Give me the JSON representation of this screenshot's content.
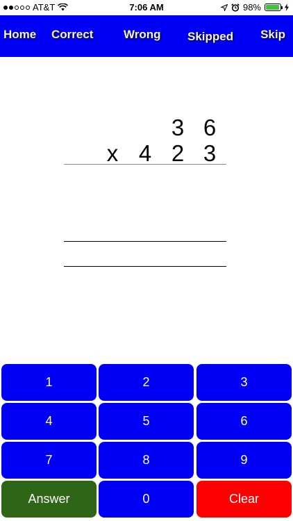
{
  "status": {
    "carrier": "AT&T",
    "time": "7:06 AM",
    "battery_text": "98%",
    "battery_level": 0.98,
    "signal_bars": 2
  },
  "nav": {
    "home": "Home",
    "correct": "Correct",
    "wrong": "Wrong",
    "skipped": "Skipped",
    "skip": "Skip"
  },
  "problem": {
    "top_digits": [
      "3",
      "6"
    ],
    "operator": "x",
    "bottom_digits": [
      "4",
      "2",
      "3"
    ]
  },
  "keypad": {
    "k1": "1",
    "k2": "2",
    "k3": "3",
    "k4": "4",
    "k5": "5",
    "k6": "6",
    "k7": "7",
    "k8": "8",
    "k9": "9",
    "answer": "Answer",
    "k0": "0",
    "clear": "Clear"
  },
  "colors": {
    "nav_background": "#0000f5",
    "key_blue": "#0000f5",
    "answer_green": "#2f6516",
    "clear_red": "#ff0000",
    "battery_green": "#3cc43c"
  }
}
